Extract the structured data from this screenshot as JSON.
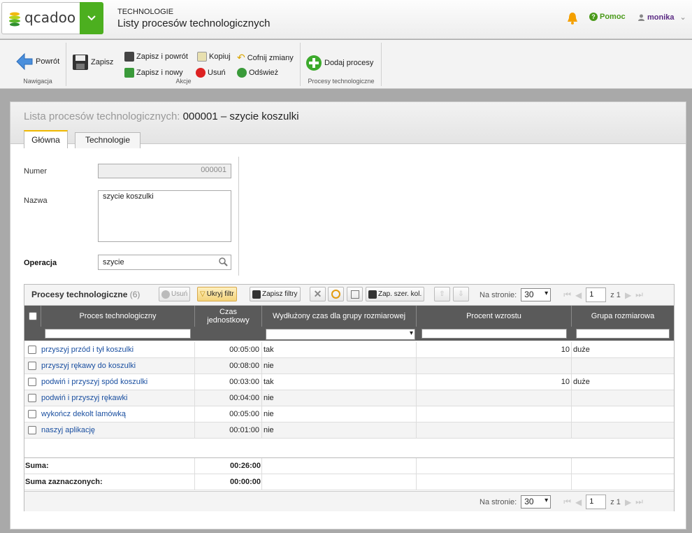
{
  "header": {
    "logo_text": "qcadoo",
    "section": "TECHNOLOGIE",
    "title": "Listy procesów technologicznych",
    "help": "Pomoc",
    "user": "monika"
  },
  "ribbon": {
    "back": "Powrót",
    "save": "Zapisz",
    "save_back": "Zapisz i powrót",
    "save_new": "Zapisz i nowy",
    "copy": "Kopiuj",
    "delete": "Usuń",
    "undo": "Cofnij zmiany",
    "refresh": "Odśwież",
    "add_processes": "Dodaj procesy",
    "group_nav": "Nawigacja",
    "group_actions": "Akcje",
    "group_processes": "Procesy technologiczne"
  },
  "form": {
    "title_prefix": "Lista procesów technologicznych:",
    "title_value": "000001 – szycie koszulki",
    "tab_main": "Główna",
    "tab_tech": "Technologie",
    "number_label": "Numer",
    "number_value": "000001",
    "name_label": "Nazwa",
    "name_value": "szycie koszulki",
    "operation_label": "Operacja",
    "operation_value": "szycie"
  },
  "grid": {
    "title": "Procesy technologiczne",
    "count": "(6)",
    "btn_delete": "Usuń",
    "btn_hide_filter": "Ukryj filtr",
    "btn_save_filters": "Zapisz filtry",
    "btn_save_cols": "Zap. szer. kol.",
    "per_page_label": "Na stronie:",
    "per_page": "30",
    "page": "1",
    "of_pages": "z 1",
    "columns": [
      "Proces technologiczny",
      "Czas jednostkowy",
      "Wydłużony czas dla grupy rozmiarowej",
      "Procent wzrostu",
      "Grupa rozmiarowa"
    ],
    "rows": [
      {
        "name": "przyszyj przód i tył koszulki",
        "time": "00:05:00",
        "ext": "tak",
        "pct": "10",
        "group": "duże"
      },
      {
        "name": "przyszyj rękawy do koszulki",
        "time": "00:08:00",
        "ext": "nie",
        "pct": "",
        "group": ""
      },
      {
        "name": "podwiń i przyszyj spód koszulki",
        "time": "00:03:00",
        "ext": "tak",
        "pct": "10",
        "group": "duże"
      },
      {
        "name": "podwiń i przyszyj rękawki",
        "time": "00:04:00",
        "ext": "nie",
        "pct": "",
        "group": ""
      },
      {
        "name": "wykończ dekolt lamówką",
        "time": "00:05:00",
        "ext": "nie",
        "pct": "",
        "group": ""
      },
      {
        "name": "naszyj aplikację",
        "time": "00:01:00",
        "ext": "nie",
        "pct": "",
        "group": ""
      }
    ],
    "sum_label": "Suma:",
    "sum_value": "00:26:00",
    "sum_sel_label": "Suma zaznaczonych:",
    "sum_sel_value": "00:00:00"
  },
  "colors": {
    "brand_green": "#4caf1f",
    "help_green": "#4a9a1a",
    "user_purple": "#5b2b84",
    "link_blue": "#1a4fa0",
    "tab_accent": "#f0b800"
  }
}
